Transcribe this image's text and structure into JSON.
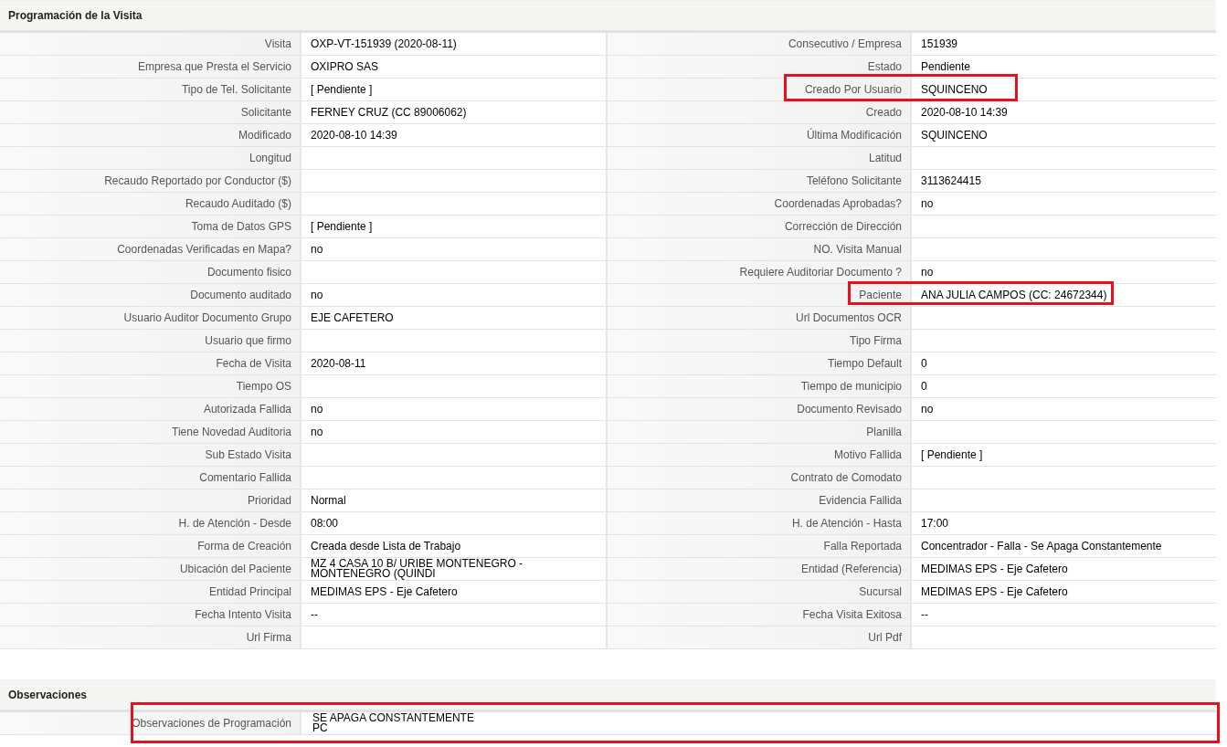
{
  "sections": [
    {
      "title": "Programación de la Visita",
      "rows": [
        {
          "left": {
            "label": "Visita",
            "value": "OXP-VT-151939 (2020-08-11)"
          },
          "right": {
            "label": "Consecutivo / Empresa",
            "value": "151939"
          }
        },
        {
          "left": {
            "label": "Empresa que Presta el Servicio",
            "value": "OXIPRO SAS"
          },
          "right": {
            "label": "Estado",
            "value": "Pendiente"
          }
        },
        {
          "left": {
            "label": "Tipo de Tel. Solicitante",
            "value": "[ Pendiente ]"
          },
          "right": {
            "label": "Creado Por Usuario",
            "value": "SQUINCENO",
            "highlighted": true
          }
        },
        {
          "left": {
            "label": "Solicitante",
            "value": "FERNEY CRUZ (CC 89006062)"
          },
          "right": {
            "label": "Creado",
            "value": "2020-08-10 14:39"
          }
        },
        {
          "left": {
            "label": "Modificado",
            "value": "2020-08-10 14:39"
          },
          "right": {
            "label": "Última Modificación",
            "value": "SQUINCENO"
          }
        },
        {
          "left": {
            "label": "Longitud"
          },
          "right": {
            "label": "Latitud"
          }
        },
        {
          "left": {
            "label": "Recaudo Reportado por Conductor ($)"
          },
          "right": {
            "label": "Teléfono Solicitante",
            "value": "3113624415"
          }
        },
        {
          "left": {
            "label": "Recaudo Auditado ($)"
          },
          "right": {
            "label": "Coordenadas Aprobadas?",
            "value": "no"
          }
        },
        {
          "left": {
            "label": "Toma de Datos GPS",
            "value": "[ Pendiente ]"
          },
          "right": {
            "label": "Corrección de Dirección"
          }
        },
        {
          "left": {
            "label": "Coordenadas Verificadas en Mapa?",
            "value": "no"
          },
          "right": {
            "label": "NO. Visita Manual"
          }
        },
        {
          "left": {
            "label": "Documento fisico"
          },
          "right": {
            "label": "Requiere Auditoriar Documento ?",
            "value": "no"
          }
        },
        {
          "left": {
            "label": "Documento auditado",
            "value": "no"
          },
          "right": {
            "label": "Paciente",
            "value": "ANA JULIA CAMPOS (CC: 24672344)",
            "highlighted": true
          }
        },
        {
          "left": {
            "label": "Usuario Auditor Documento Grupo",
            "value": "EJE CAFETERO"
          },
          "right": {
            "label": "Url Documentos OCR"
          }
        },
        {
          "left": {
            "label": "Usuario que firmo"
          },
          "right": {
            "label": "Tipo Firma"
          }
        },
        {
          "left": {
            "label": "Fecha de Visita",
            "value": "2020-08-11"
          },
          "right": {
            "label": "Tiempo Default",
            "value": "0"
          }
        },
        {
          "left": {
            "label": "Tiempo OS"
          },
          "right": {
            "label": "Tiempo de municipio",
            "value": "0"
          }
        },
        {
          "left": {
            "label": "Autorizada Fallida",
            "value": "no"
          },
          "right": {
            "label": "Documento Revisado",
            "value": "no"
          }
        },
        {
          "left": {
            "label": "Tiene Novedad Auditoria",
            "value": "no"
          },
          "right": {
            "label": "Planilla"
          }
        },
        {
          "left": {
            "label": "Sub Estado Visita"
          },
          "right": {
            "label": "Motivo Fallida",
            "value": "[ Pendiente ]"
          }
        },
        {
          "left": {
            "label": "Comentario Fallida"
          },
          "right": {
            "label": "Contrato de Comodato"
          }
        },
        {
          "left": {
            "label": "Prioridad",
            "value": "Normal"
          },
          "right": {
            "label": "Evidencia Fallida"
          }
        },
        {
          "left": {
            "label": "H. de Atención - Desde",
            "value": "08:00"
          },
          "right": {
            "label": "H. de Atención - Hasta",
            "value": "17:00"
          }
        },
        {
          "left": {
            "label": "Forma de Creación",
            "value": "Creada desde Lista de Trabajo"
          },
          "right": {
            "label": "Falla Reportada",
            "value": "Concentrador - Falla - Se Apaga Constantemente"
          }
        },
        {
          "left": {
            "label": "Ubicación del Paciente",
            "value": "MZ 4 CASA 10 B/ URIBE MONTENEGRO - MONTENEGRO (QUINDI"
          },
          "right": {
            "label": "Entidad (Referencia)",
            "value": "MEDIMAS EPS - Eje Cafetero"
          }
        },
        {
          "left": {
            "label": "Entidad Principal",
            "value": "MEDIMAS EPS - Eje Cafetero"
          },
          "right": {
            "label": "Sucursal",
            "value": "MEDIMAS EPS - Eje Cafetero"
          }
        },
        {
          "left": {
            "label": "Fecha Intento Visita",
            "value": "--"
          },
          "right": {
            "label": "Fecha Visita Exitosa",
            "value": "--"
          }
        },
        {
          "left": {
            "label": "Url Firma"
          },
          "right": {
            "label": "Url Pdf"
          }
        }
      ]
    }
  ],
  "observations": {
    "title": "Observaciones",
    "label": "Observaciones de Programación",
    "value": "SE APAGA CONSTANTEMENTE\nPC",
    "highlighted": true
  }
}
